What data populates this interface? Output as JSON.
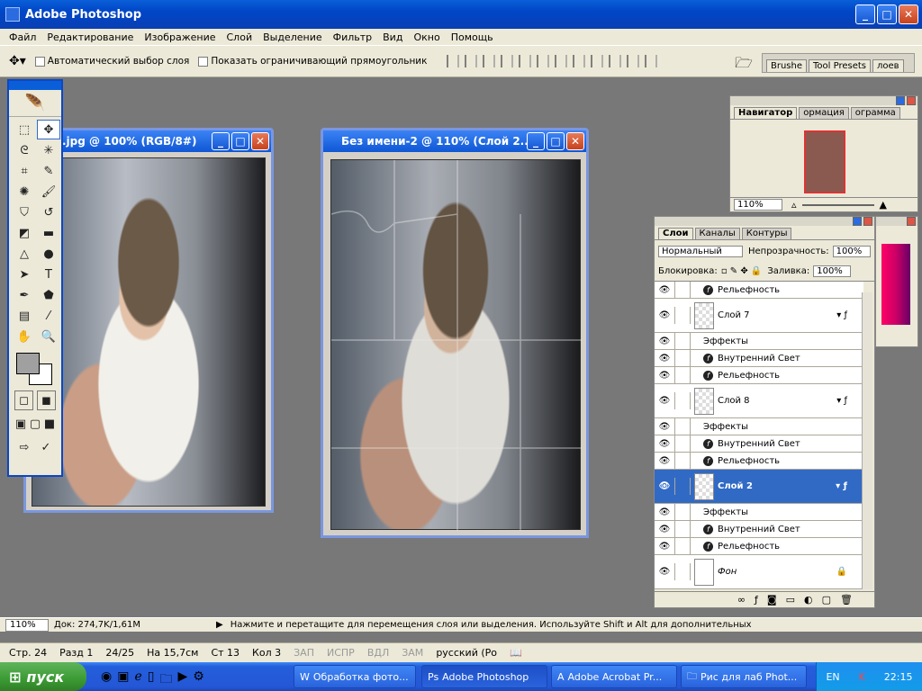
{
  "app": {
    "title": "Adobe Photoshop"
  },
  "menu": [
    "Файл",
    "Редактирование",
    "Изображение",
    "Слой",
    "Выделение",
    "Фильтр",
    "Вид",
    "Окно",
    "Помощь"
  ],
  "options": {
    "auto_select": "Автоматический выбор слоя",
    "show_bbox": "Показать ограничивающий прямоугольник",
    "palette_tabs": [
      "Brushe",
      "Tool Presets",
      "лоев"
    ]
  },
  "docs": {
    "doc1_title": ".jpg @ 100% (RGB/8#)",
    "doc2_title": "Без имени-2 @ 110% (Слой 2..."
  },
  "navigator": {
    "tabs": [
      "Навигатор",
      "ормация",
      "ограмма"
    ],
    "zoom": "110%"
  },
  "layers": {
    "tabs": [
      "Слои",
      "Каналы",
      "Контуры"
    ],
    "blend_mode": "Нормальный",
    "opacity_label": "Непрозрачность:",
    "opacity": "100%",
    "lock_label": "Блокировка:",
    "fill_label": "Заливка:",
    "fill": "100%",
    "rows": [
      {
        "type": "fx",
        "label": "Рельефность"
      },
      {
        "type": "layer",
        "label": "Слой 7"
      },
      {
        "type": "effects",
        "label": "Эффекты"
      },
      {
        "type": "fx",
        "label": "Внутренний Свет"
      },
      {
        "type": "fx",
        "label": "Рельефность"
      },
      {
        "type": "layer",
        "label": "Слой 8"
      },
      {
        "type": "effects",
        "label": "Эффекты"
      },
      {
        "type": "fx",
        "label": "Внутренний Свет"
      },
      {
        "type": "fx",
        "label": "Рельефность"
      },
      {
        "type": "layer",
        "label": "Слой 2",
        "selected": true
      },
      {
        "type": "effects",
        "label": "Эффекты"
      },
      {
        "type": "fx",
        "label": "Внутренний Свет"
      },
      {
        "type": "fx",
        "label": "Рельефность"
      },
      {
        "type": "layer",
        "label": "Фон",
        "locked": true
      }
    ]
  },
  "status": {
    "zoom": "110%",
    "doc": "Док: 274,7K/1,61M",
    "hint": "Нажмите и перетащите для перемещения слоя или выделения. Используйте Shift и Alt для дополнительных"
  },
  "word_status": {
    "page": "Стр. 24",
    "section": "Разд 1",
    "pages": "24/25",
    "at": "На 15,7см",
    "line": "Ст 13",
    "col": "Кол 3",
    "modes": [
      "ЗАП",
      "ИСПР",
      "ВДЛ",
      "ЗАМ"
    ],
    "lang": "русский (Ро"
  },
  "taskbar": {
    "start": "пуск",
    "buttons": [
      "Обработка фото...",
      "Adobe Photoshop",
      "Adobe Acrobat Pr...",
      "Рис для лаб Phot..."
    ],
    "lang": "EN",
    "clock": "22:15"
  }
}
